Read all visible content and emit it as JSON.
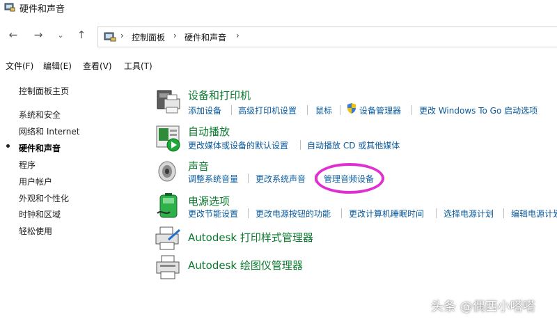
{
  "window": {
    "title": "硬件和声音"
  },
  "navigation": {
    "back_icon": "arrow-left-icon",
    "forward_icon": "arrow-right-icon",
    "recent_icon": "chevron-down-icon",
    "up_icon": "arrow-up-icon",
    "breadcrumb": [
      "控制面板",
      "硬件和声音"
    ]
  },
  "menu": [
    "文件(F)",
    "编辑(E)",
    "查看(V)",
    "工具(T)"
  ],
  "sidebar": {
    "items": [
      {
        "label": "控制面板主页",
        "active": false
      },
      {
        "label": "系统和安全",
        "active": false
      },
      {
        "label": "网络和 Internet",
        "active": false
      },
      {
        "label": "硬件和声音",
        "active": true
      },
      {
        "label": "程序",
        "active": false
      },
      {
        "label": "用户帐户",
        "active": false
      },
      {
        "label": "外观和个性化",
        "active": false
      },
      {
        "label": "时钟和区域",
        "active": false
      },
      {
        "label": "轻松使用",
        "active": false
      }
    ]
  },
  "categories": [
    {
      "title": "设备和打印机",
      "icon": "printer-device-icon",
      "links": [
        "添加设备",
        "高级打印机设置",
        "鼠标",
        "设备管理器",
        "更改 Windows To Go 启动选项"
      ]
    },
    {
      "title": "自动播放",
      "icon": "autoplay-icon",
      "links": [
        "更改媒体或设备的默认设置",
        "自动播放 CD 或其他媒体"
      ]
    },
    {
      "title": "声音",
      "icon": "speaker-icon",
      "links": [
        "调整系统音量",
        "更改系统声音",
        "管理音频设备"
      ]
    },
    {
      "title": "电源选项",
      "icon": "battery-icon",
      "links": [
        "更改节能设置",
        "更改电源按钮的功能",
        "更改计算机睡眠时间",
        "选择电源计划",
        "编辑电源计划"
      ]
    },
    {
      "title": "Autodesk 打印样式管理器",
      "icon": "print-style-icon",
      "links": []
    },
    {
      "title": "Autodesk 绘图仪管理器",
      "icon": "plotter-icon",
      "links": []
    }
  ],
  "shield_icon": "uac-shield-icon",
  "annotation": {
    "highlighted_link": "管理音频设备",
    "color": "#e02fd0"
  },
  "watermark": "头条 @偶西小嗒嗒",
  "colors": {
    "category_title": "#0b7a2e",
    "link": "#0a5a9c"
  }
}
